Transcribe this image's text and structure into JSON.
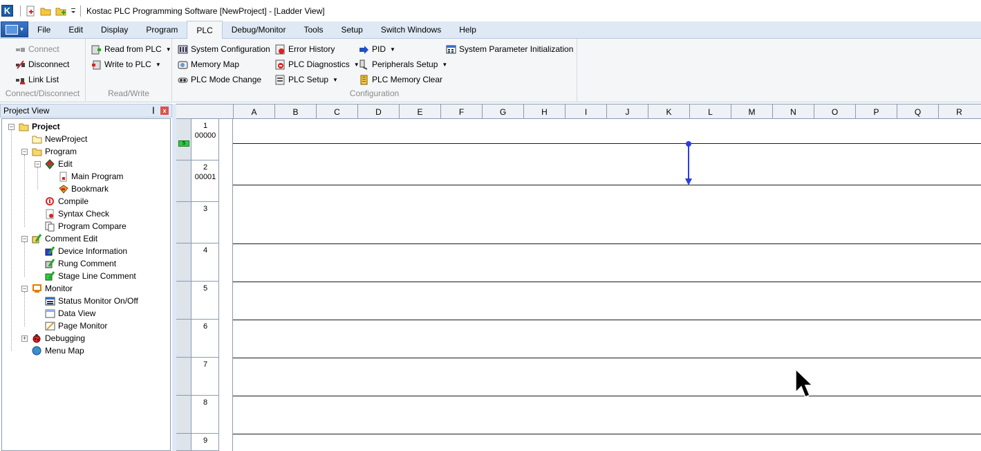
{
  "titlebar": {
    "logo_letter": "K",
    "title": "Kostac PLC Programming Software [NewProject] - [Ladder View]"
  },
  "menu": {
    "tabs": [
      {
        "label": "File"
      },
      {
        "label": "Edit"
      },
      {
        "label": "Display"
      },
      {
        "label": "Program"
      },
      {
        "label": "PLC"
      },
      {
        "label": "Debug/Monitor"
      },
      {
        "label": "Tools"
      },
      {
        "label": "Setup"
      },
      {
        "label": "Switch Windows"
      },
      {
        "label": "Help"
      }
    ],
    "active_tab": "PLC"
  },
  "ribbon": {
    "groups": {
      "connect": {
        "label": "Connect/Disconnect",
        "connect": "Connect",
        "disconnect": "Disconnect",
        "link_list": "Link List"
      },
      "readwrite": {
        "label": "Read/Write",
        "read": "Read from PLC",
        "write": "Write to PLC"
      },
      "configuration": {
        "label": "Configuration",
        "system_configuration": "System Configuration",
        "memory_map": "Memory Map",
        "plc_mode_change": "PLC Mode Change",
        "error_history": "Error History",
        "plc_diagnostics": "PLC Diagnostics",
        "plc_setup": "PLC Setup",
        "pid": "PID",
        "peripherals_setup": "Peripherals Setup",
        "plc_memory_clear": "PLC Memory Clear",
        "system_parameter_initialization": "System Parameter Initialization"
      }
    }
  },
  "project_view": {
    "title": "Project View",
    "pin": "❙",
    "close": "x",
    "items": {
      "project": "Project",
      "newproject": "NewProject",
      "program": "Program",
      "edit": "Edit",
      "main_program": "Main Program",
      "bookmark": "Bookmark",
      "compile": "Compile",
      "syntax_check": "Syntax Check",
      "program_compare": "Program Compare",
      "comment_edit": "Comment Edit",
      "device_information": "Device Information",
      "rung_comment": "Rung Comment",
      "stage_line_comment": "Stage Line Comment",
      "monitor": "Monitor",
      "status_monitor": "Status Monitor On/Off",
      "data_view": "Data View",
      "page_monitor": "Page Monitor",
      "debugging": "Debugging",
      "menu_map": "Menu Map"
    }
  },
  "ladder": {
    "columns": [
      "A",
      "B",
      "C",
      "D",
      "E",
      "F",
      "G",
      "H",
      "I",
      "J",
      "K",
      "L",
      "M",
      "N",
      "O",
      "P",
      "Q",
      "R"
    ],
    "rungs": [
      {
        "num": "1",
        "addr": "00000"
      },
      {
        "num": "2",
        "addr": "00001"
      },
      {
        "num": "3",
        "addr": ""
      },
      {
        "num": "4",
        "addr": ""
      },
      {
        "num": "5",
        "addr": ""
      },
      {
        "num": "6",
        "addr": ""
      },
      {
        "num": "7",
        "addr": ""
      },
      {
        "num": "8",
        "addr": ""
      },
      {
        "num": "9",
        "addr": ""
      }
    ],
    "stage_marker": "S",
    "colors": {
      "vertical_connector": "#2b3fe0"
    }
  }
}
